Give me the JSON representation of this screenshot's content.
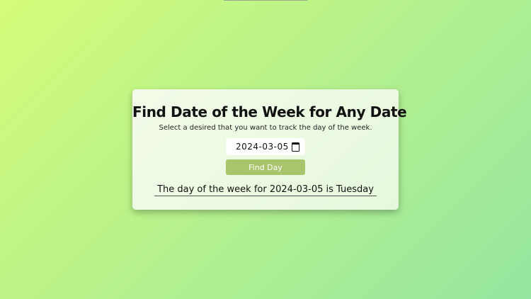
{
  "card": {
    "title": "Find Date of the Week for Any Date",
    "subtitle": "Select a desired that you want to track the day of the week.",
    "date_value": "2024-03-05",
    "button_label": "Find Day",
    "result_text": "The day of the week for 2024-03-05 is Tuesday"
  },
  "icons": {
    "date_picker": "calendar-icon"
  },
  "colors": {
    "background_start": "#d4fc79",
    "background_end": "#96e6a1",
    "button": "#a9c46b",
    "card": "#eef9e6"
  }
}
